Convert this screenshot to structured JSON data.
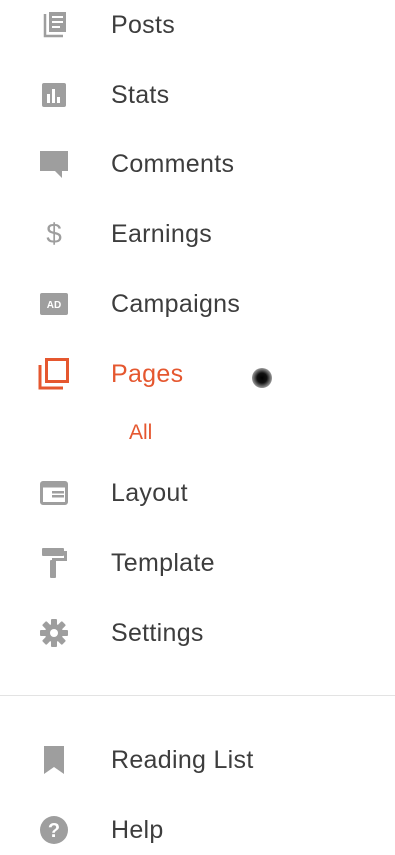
{
  "sidebar": {
    "items": [
      {
        "label": "Posts",
        "icon": "posts-icon"
      },
      {
        "label": "Stats",
        "icon": "stats-icon"
      },
      {
        "label": "Comments",
        "icon": "comments-icon"
      },
      {
        "label": "Earnings",
        "icon": "earnings-icon"
      },
      {
        "label": "Campaigns",
        "icon": "campaigns-icon"
      },
      {
        "label": "Pages",
        "icon": "pages-icon",
        "active": true
      },
      {
        "label": "Layout",
        "icon": "layout-icon"
      },
      {
        "label": "Template",
        "icon": "template-icon"
      },
      {
        "label": "Settings",
        "icon": "settings-icon"
      }
    ],
    "sub_items": [
      {
        "label": "All"
      }
    ],
    "footer_items": [
      {
        "label": "Reading List",
        "icon": "bookmark-icon"
      },
      {
        "label": "Help",
        "icon": "help-icon"
      }
    ]
  },
  "colors": {
    "accent": "#e5572f",
    "icon": "#9e9e9e",
    "text": "#3d3d3d"
  }
}
